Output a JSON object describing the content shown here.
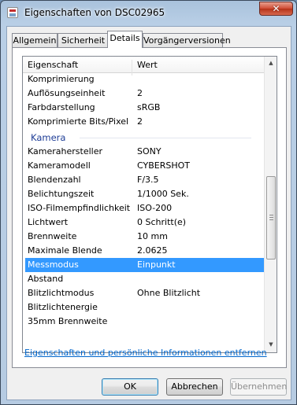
{
  "window": {
    "title": "Eigenschaften von DSC02965",
    "close_symbol": "✕"
  },
  "tabs": [
    {
      "label": "Allgemein",
      "active": false
    },
    {
      "label": "Sicherheit",
      "active": false
    },
    {
      "label": "Details",
      "active": true
    },
    {
      "label": "Vorgängerversionen",
      "active": false
    }
  ],
  "list": {
    "header": {
      "property": "Eigenschaft",
      "value": "Wert"
    },
    "rows_top": [
      {
        "property": "Komprimierung",
        "value": ""
      },
      {
        "property": "Auflösungseinheit",
        "value": "2"
      },
      {
        "property": "Farbdarstellung",
        "value": "sRGB"
      },
      {
        "property": "Komprimierte Bits/Pixel",
        "value": "2"
      }
    ],
    "group_label": "Kamera",
    "rows_camera": [
      {
        "property": "Kamerahersteller",
        "value": "SONY"
      },
      {
        "property": "Kameramodell",
        "value": "CYBERSHOT"
      },
      {
        "property": "Blendenzahl",
        "value": "F/3.5"
      },
      {
        "property": "Belichtungszeit",
        "value": "1/1000 Sek."
      },
      {
        "property": "ISO-Filmempfindlichkeit",
        "value": "ISO-200"
      },
      {
        "property": "Lichtwert",
        "value": "0 Schritt(e)"
      },
      {
        "property": "Brennweite",
        "value": "10 mm"
      },
      {
        "property": "Maximale Blende",
        "value": "2.0625"
      },
      {
        "property": "Messmodus",
        "value": "Einpunkt",
        "selected": true
      },
      {
        "property": "Abstand",
        "value": ""
      },
      {
        "property": "Blitzlichtmodus",
        "value": "Ohne Blitzlicht"
      },
      {
        "property": "Blitzlichtenergie",
        "value": ""
      },
      {
        "property": "35mm Brennweite",
        "value": ""
      }
    ]
  },
  "remove_link": "Eigenschaften und persönliche Informationen entfernen",
  "buttons": {
    "ok": "OK",
    "cancel": "Abbrechen",
    "apply": "Übernehmen"
  },
  "colors": {
    "selection": "#3399ff",
    "group_label": "#1e3d96",
    "link": "#0066cc"
  }
}
